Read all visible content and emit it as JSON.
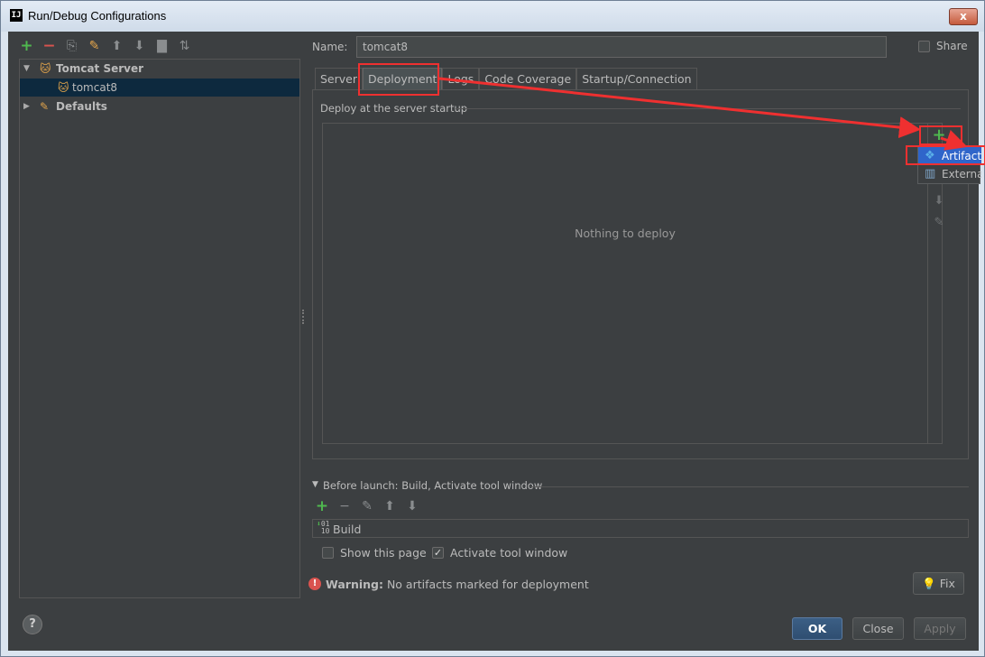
{
  "window": {
    "title": "Run/Debug Configurations",
    "app_icon": "IJ",
    "close": "x"
  },
  "left_toolbar": {
    "icons": [
      "add-icon",
      "remove-icon",
      "copy-icon",
      "wrench-icon",
      "move-up-icon",
      "move-down-icon",
      "folder-icon",
      "sort-icon"
    ],
    "add": "+",
    "remove": "−",
    "copy": "⎘",
    "wrench": "✎",
    "up": "⬆",
    "down": "⬇",
    "folder": "▇",
    "sort": "⇅"
  },
  "tree": {
    "tomcat_server": "Tomcat Server",
    "tomcat8": "tomcat8",
    "defaults": "Defaults"
  },
  "name": {
    "label": "Name:",
    "value": "tomcat8"
  },
  "share": {
    "label": "Share",
    "checked": false
  },
  "tabs": [
    {
      "label": "Server"
    },
    {
      "label": "Deployment",
      "active": true
    },
    {
      "label": "Logs"
    },
    {
      "label": "Code Coverage"
    },
    {
      "label": "Startup/Connection"
    }
  ],
  "deployment": {
    "group_title": "Deploy at the server startup",
    "empty_text": "Nothing to deploy",
    "add": "+",
    "down": "⬇",
    "edit": "✎"
  },
  "popup": {
    "items": [
      {
        "label": "Artifact...",
        "icon": "artifact-icon",
        "selected": true
      },
      {
        "label": "External",
        "icon": "external-source-icon",
        "selected": false
      }
    ]
  },
  "before_launch": {
    "title": "Before launch: Build, Activate tool window",
    "add": "+",
    "remove": "−",
    "edit": "✎",
    "up": "⬆",
    "down": "⬇",
    "build_label": "Build"
  },
  "options": {
    "show_page": {
      "label": "Show this page",
      "checked": false
    },
    "activate_tool": {
      "label": "Activate tool window",
      "checked": true
    }
  },
  "warning": {
    "prefix": "Warning:",
    "text": " No artifacts marked for deployment"
  },
  "buttons": {
    "fix": "Fix",
    "ok": "OK",
    "close": "Close",
    "apply": "Apply",
    "help": "?"
  },
  "colors": {
    "annotation": "#ef3030",
    "accent": "#2f65ca",
    "add_green": "#4fb84f"
  }
}
